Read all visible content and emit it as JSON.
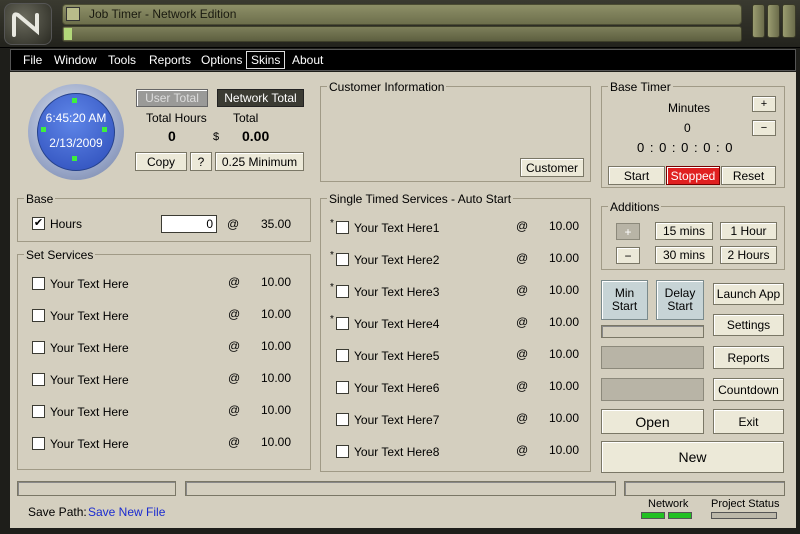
{
  "window": {
    "title": "Job Timer - Network Edition"
  },
  "menu": [
    "File",
    "Window",
    "Tools",
    "Reports",
    "Options",
    "Skins",
    "About"
  ],
  "clock": {
    "time": "6:45:20 AM",
    "date": "2/13/2009"
  },
  "totals": {
    "user_total_label": "User Total",
    "network_total_label": "Network Total",
    "total_hours_label": "Total Hours",
    "total_label": "Total",
    "total_hours_value": "0",
    "currency": "$",
    "total_value": "0.00",
    "copy_label": "Copy",
    "help_label": "?",
    "minimum_label": "0.25 Minimum"
  },
  "customer": {
    "title": "Customer Information",
    "button_label": "Customer"
  },
  "base_timer": {
    "title": "Base Timer",
    "minutes_label": "Minutes",
    "minutes_value": "0",
    "plus_label": "+",
    "minus_label": "−",
    "digits": "0 : 0 : 0 : 0 : 0",
    "start_label": "Start",
    "status_label": "Stopped",
    "reset_label": "Reset"
  },
  "additions": {
    "title": "Additions",
    "plus_label": "+",
    "minus_label": "−",
    "buttons": [
      "15 mins",
      "1 Hour",
      "30 mins",
      "2 Hours"
    ]
  },
  "base": {
    "title": "Base",
    "hours_label": "Hours",
    "hours_value": "0",
    "at": "@",
    "rate": "35.00",
    "checked": true
  },
  "set_services": {
    "title": "Set Services",
    "items": [
      {
        "label": "Your Text Here",
        "at": "@",
        "rate": "10.00"
      },
      {
        "label": "Your Text Here",
        "at": "@",
        "rate": "10.00"
      },
      {
        "label": "Your Text Here",
        "at": "@",
        "rate": "10.00"
      },
      {
        "label": "Your Text Here",
        "at": "@",
        "rate": "10.00"
      },
      {
        "label": "Your Text Here",
        "at": "@",
        "rate": "10.00"
      },
      {
        "label": "Your Text Here",
        "at": "@",
        "rate": "10.00"
      }
    ]
  },
  "timed_services": {
    "title": "Single Timed Services - Auto Start",
    "items": [
      {
        "star": "*",
        "label": "Your Text Here1",
        "at": "@",
        "rate": "10.00"
      },
      {
        "star": "*",
        "label": "Your Text Here2",
        "at": "@",
        "rate": "10.00"
      },
      {
        "star": "*",
        "label": "Your Text Here3",
        "at": "@",
        "rate": "10.00"
      },
      {
        "star": "*",
        "label": "Your Text Here4",
        "at": "@",
        "rate": "10.00"
      },
      {
        "star": "",
        "label": "Your Text Here5",
        "at": "@",
        "rate": "10.00"
      },
      {
        "star": "",
        "label": "Your Text Here6",
        "at": "@",
        "rate": "10.00"
      },
      {
        "star": "",
        "label": "Your Text Here7",
        "at": "@",
        "rate": "10.00"
      },
      {
        "star": "",
        "label": "Your Text Here8",
        "at": "@",
        "rate": "10.00"
      }
    ]
  },
  "actions": {
    "min_start": "Min\nStart",
    "delay_start": "Delay\nStart",
    "launch_app": "Launch App",
    "settings": "Settings",
    "reports": "Reports",
    "countdown": "Countdown",
    "open": "Open",
    "exit": "Exit",
    "new": "New"
  },
  "footer": {
    "save_path_label": "Save Path:",
    "save_path_value": "Save New File",
    "network_label": "Network",
    "project_status_label": "Project Status"
  },
  "colors": {
    "accent_red": "#e02020",
    "network_green": "#22c022",
    "link_blue": "#1a2bd0"
  }
}
